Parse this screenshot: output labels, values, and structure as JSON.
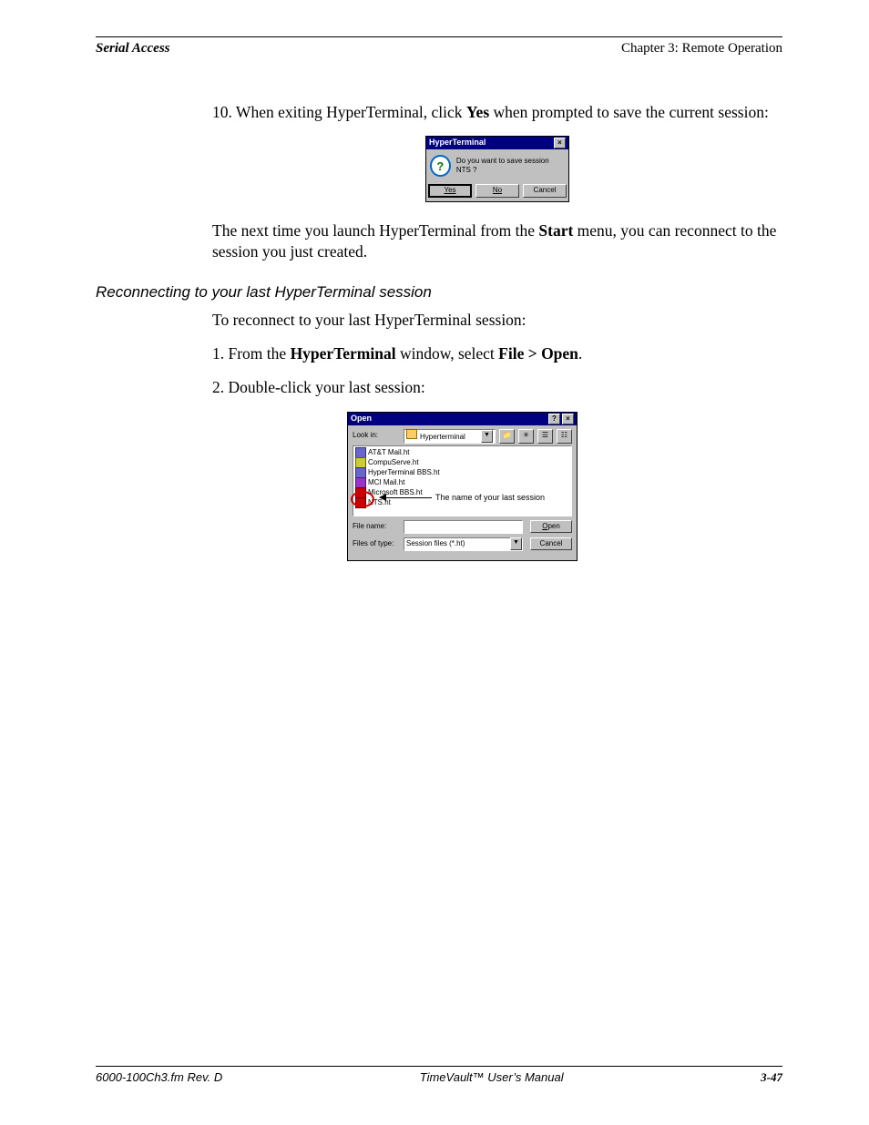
{
  "header": {
    "left": "Serial Access",
    "right": "Chapter 3: Remote Operation"
  },
  "step10": {
    "num": "10.",
    "text_before": " When exiting HyperTerminal, click ",
    "bold1": "Yes",
    "text_after": " when prompted to save the current session:"
  },
  "dlg1": {
    "title": "HyperTerminal",
    "question": "Do you want to save session NTS ?",
    "yes": "Yes",
    "no": "No",
    "cancel": "Cancel"
  },
  "para_next": {
    "t1": "The next time you launch HyperTerminal from the ",
    "b1": "Start",
    "t2": " menu, you can reconnect to the session you just created."
  },
  "subhead": "Reconnecting to your last HyperTerminal session",
  "para_intro": "To reconnect to your last HyperTerminal session:",
  "step1": {
    "num": "1.",
    "t1": " From the ",
    "b1": "HyperTerminal",
    "t2": " window, select ",
    "b2": "File > Open",
    "t3": "."
  },
  "step2": {
    "num": "2.",
    "text": " Double-click your last session:"
  },
  "dlg2": {
    "title": "Open",
    "lookin_label": "Look in:",
    "lookin_value": "Hyperterminal",
    "files": [
      "AT&T Mail.ht",
      "CompuServe.ht",
      "HyperTerminal BBS.ht",
      "MCI Mail.ht",
      "Microsoft BBS.ht",
      "NTS.ht"
    ],
    "annotation": "The name of your last session",
    "filename_label": "File name:",
    "filename_value": "",
    "filetype_label": "Files of type:",
    "filetype_value": "Session files (*.ht)",
    "open_btn": "Open",
    "cancel_btn": "Cancel"
  },
  "footer": {
    "left": "6000-100Ch3.fm  Rev. D",
    "center": "TimeVault™ User’s Manual",
    "right": "3-47"
  }
}
